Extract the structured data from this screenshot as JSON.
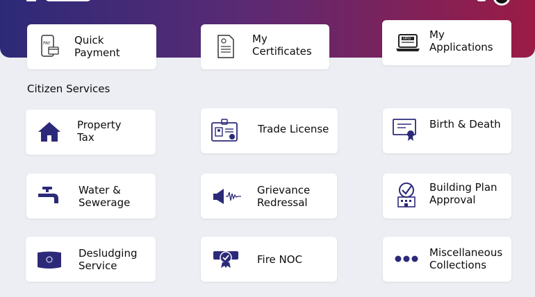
{
  "quick_links": [
    {
      "line1": "Quick",
      "line2": "Payment",
      "icon": "pay-icon"
    },
    {
      "line1": "My",
      "line2": "Certificates",
      "icon": "certificate-icon"
    },
    {
      "line1": "My",
      "line2": "Applications",
      "icon": "laptop-apply-icon"
    }
  ],
  "section_title": "Citizen Services",
  "services": [
    {
      "line1": "Property",
      "line2": "Tax",
      "icon": "home-icon"
    },
    {
      "line1": "Trade License",
      "line2": "",
      "icon": "id-card-icon"
    },
    {
      "line1": "Birth & Death",
      "line2": "",
      "icon": "certificate-ribbon-icon"
    },
    {
      "line1": "Water &",
      "line2": "Sewerage",
      "icon": "tap-icon"
    },
    {
      "line1": "Grievance",
      "line2": "Redressal",
      "icon": "megaphone-icon"
    },
    {
      "line1": "Building Plan",
      "line2": "Approval",
      "icon": "building-check-icon"
    },
    {
      "line1": "Desludging",
      "line2": "Service",
      "icon": "tank-icon"
    },
    {
      "line1": "Fire NOC",
      "line2": "",
      "icon": "fire-noc-icon"
    },
    {
      "line1": "Miscellaneous",
      "line2": "Collections",
      "icon": "more-dots-icon"
    }
  ],
  "colors": {
    "icon": "#2c2a78",
    "header_start": "#2c2a78",
    "header_end": "#9b1b45"
  }
}
